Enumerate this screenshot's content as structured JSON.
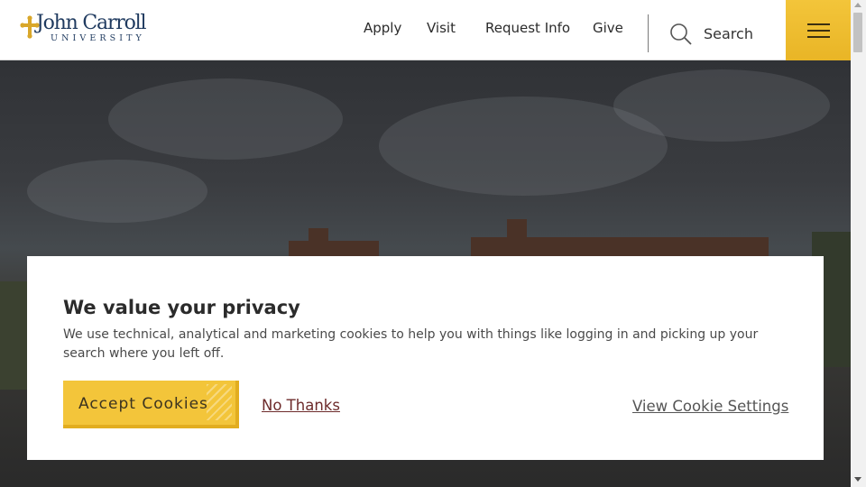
{
  "header": {
    "logo": {
      "name": "John Carroll",
      "subtitle": "UNIVERSITY"
    },
    "nav": [
      "Apply",
      "Visit",
      "Request Info",
      "Give"
    ],
    "search_label": "Search",
    "menu_icon": "hamburger-icon",
    "accent_color": "#f3c53a"
  },
  "cookie_banner": {
    "title": "We value your privacy",
    "text": "We use technical, analytical and marketing cookies to help you with things like logging in and picking up your search where you left off.",
    "accept_label": "Accept Cookies",
    "decline_label": "No Thanks",
    "settings_label": "View Cookie Settings"
  }
}
